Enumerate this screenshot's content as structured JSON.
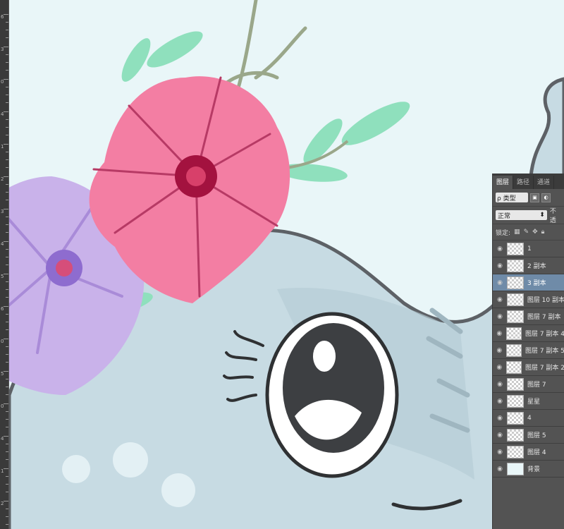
{
  "ruler": {
    "labels": [
      "6",
      "3",
      "0",
      "4",
      "1",
      "2",
      "3",
      "4",
      "5",
      "6",
      "0",
      "5",
      "0",
      "4",
      "1",
      "2"
    ]
  },
  "colors": {
    "background": "#e9f6f8",
    "elephant": "#c7dbe3",
    "outline": "#5d6166",
    "pink_flower": "#f37ea3",
    "purple_flower": "#c9b2ea",
    "leaf_green": "#8fe0bd",
    "selected_layer": "#6f8ba8"
  },
  "layers_panel": {
    "tabs": [
      "图层",
      "路径",
      "通道"
    ],
    "filter_label": "ρ 类型",
    "blend_mode": "正常",
    "opacity_label": "不透",
    "lock_label": "锁定:",
    "layers": [
      {
        "name": "1",
        "selected": false
      },
      {
        "name": "2 副本",
        "selected": false
      },
      {
        "name": "3 副本",
        "selected": true
      },
      {
        "name": "图层 10 副本",
        "selected": false
      },
      {
        "name": "图层 7 副本",
        "selected": false
      },
      {
        "name": "图层 7 副本 4",
        "selected": false
      },
      {
        "name": "图层 7 副本 5",
        "selected": false
      },
      {
        "name": "图层 7 副本 2",
        "selected": false
      },
      {
        "name": "图层 7",
        "selected": false
      },
      {
        "name": "星星",
        "selected": false
      },
      {
        "name": "4",
        "selected": false
      },
      {
        "name": "图层 5",
        "selected": false
      },
      {
        "name": "图层 4",
        "selected": false
      },
      {
        "name": "背景",
        "selected": false
      }
    ]
  }
}
